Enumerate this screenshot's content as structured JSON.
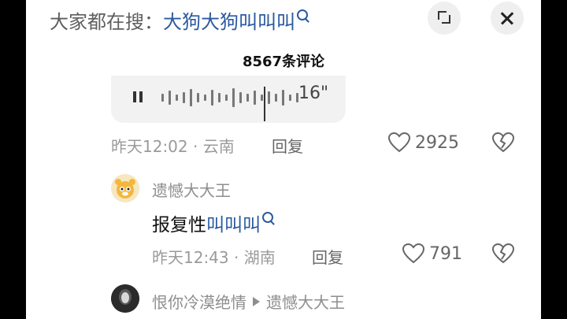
{
  "search": {
    "prefix": "大家都在搜：",
    "query": "大狗大狗叫叫叫"
  },
  "header": {
    "comment_count": "8567条评论"
  },
  "voice_comment": {
    "duration": "16\"",
    "time": "昨天12:02",
    "location": "云南",
    "reply_label": "回复",
    "likes": "2925"
  },
  "comment_1": {
    "username": "遗憾大大王",
    "text_plain": "报复性",
    "text_keyword": "叫叫叫",
    "time": "昨天12:43",
    "location": "湖南",
    "reply_label": "回复",
    "likes": "791"
  },
  "comment_2": {
    "username": "恨你冷漠绝情",
    "reply_to": "遗憾大大王"
  },
  "icons": {
    "expand": "expand-icon",
    "close": "close-icon",
    "like": "heart-icon",
    "dislike": "broken-heart-icon",
    "search": "search-icon",
    "pause": "pause-icon"
  },
  "colors": {
    "keyword": "#2a5aa0",
    "muted": "#9a9a9a"
  }
}
